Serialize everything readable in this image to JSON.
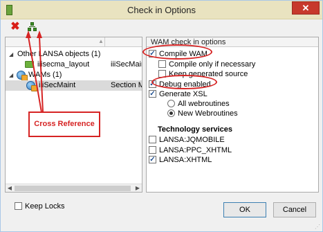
{
  "window": {
    "title": "Check in Options",
    "close_glyph": "✕"
  },
  "toolbar": {
    "delete_icon": "delete-icon",
    "xref_icon": "cross-reference-icon",
    "delete_glyph": "✖"
  },
  "tree": {
    "rows": [
      {
        "label": "Other LANSA objects (1)",
        "col2": ""
      },
      {
        "label": "iiisecma_layout",
        "col2": "iiiSecMaint"
      },
      {
        "label": "WAMs (1)",
        "col2": ""
      },
      {
        "label": "iiiSecMaint",
        "col2": "Section Mai"
      }
    ]
  },
  "options": {
    "header": "WAM check in options",
    "compile_wam": "Compile WAM",
    "compile_only": "Compile only if necessary",
    "keep_generated": "Keep generated source",
    "debug_enabled": "Debug enabled",
    "generate_xsl": "Generate XSL",
    "all_webroutines": "All webroutines",
    "new_webroutines": "New Webroutines",
    "tech_header": "Technology services",
    "tech": [
      {
        "label": "LANSA:JQMOBILE",
        "checked": false
      },
      {
        "label": "LANSA:PPC_XHTML",
        "checked": false
      },
      {
        "label": "LANSA:XHTML",
        "checked": true
      }
    ],
    "check_glyph": "✓"
  },
  "footer": {
    "keep_locks": "Keep Locks",
    "ok": "OK",
    "cancel": "Cancel"
  },
  "annotation": {
    "label": "Cross Reference",
    "color": "#d62323"
  }
}
